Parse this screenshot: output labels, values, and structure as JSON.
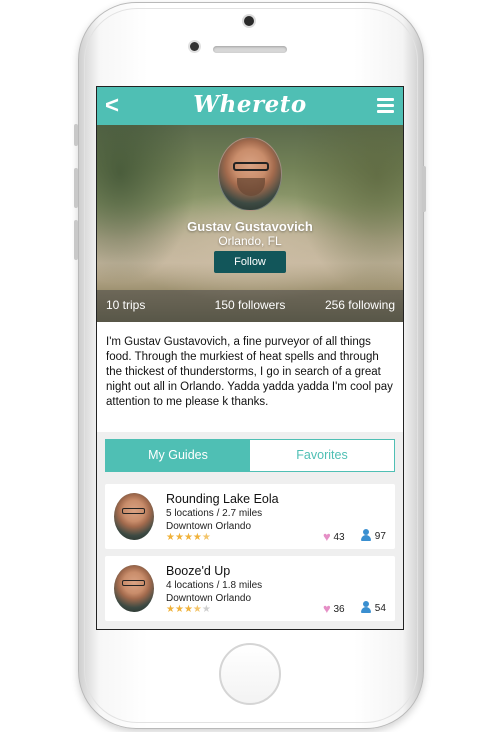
{
  "app": {
    "title": "Whereto",
    "back_label": "<",
    "menu_icon": "hamburger-menu-icon",
    "accent_color": "#4fbfb4",
    "button_color": "#12565a"
  },
  "profile": {
    "name": "Gustav Gustavovich",
    "location": "Orlando, FL",
    "follow_label": "Follow",
    "stats": {
      "trips": "10 trips",
      "followers": "150 followers",
      "following": "256 following"
    },
    "bio": "I'm Gustav Gustavovich, a fine purveyor of all things food. Through the murkiest of heat spells and through the thickest of thunderstorms, I go in search of a great night out all in Orlando. Yadda yadda yadda I'm cool pay attention to me please k thanks."
  },
  "tabs": [
    {
      "label": "My Guides",
      "active": true
    },
    {
      "label": "Favorites",
      "active": false
    }
  ],
  "guides": [
    {
      "title": "Rounding Lake Eola",
      "details": "5 locations / 2.7 miles",
      "area": "Downtown Orlando",
      "rating": 4.5,
      "likes": "43",
      "views": "97"
    },
    {
      "title": "Booze'd Up",
      "details": "4 locations / 1.8 miles",
      "area": "Downtown Orlando",
      "rating": 3.5,
      "likes": "36",
      "views": "54"
    }
  ]
}
